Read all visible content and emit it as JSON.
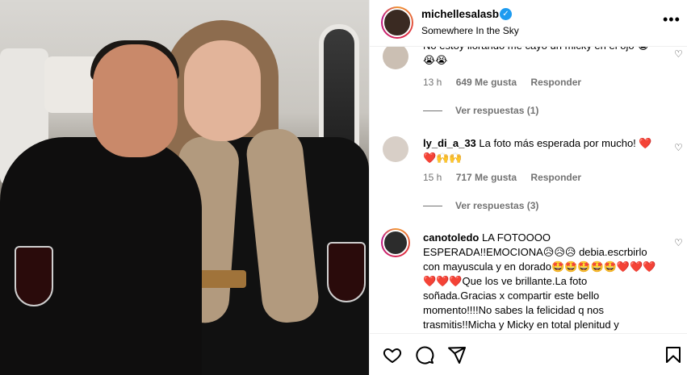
{
  "post": {
    "username": "michellesalasb",
    "location": "Somewhere In the Sky"
  },
  "comments": [
    {
      "text": "No estoy llorando me cayo un micky en el ojo 😭😭😭",
      "time": "13 h",
      "likes": "649 Me gusta",
      "reply": "Responder",
      "view_replies": "Ver respuestas (1)"
    },
    {
      "user": "ly_di_a_33",
      "text": "La foto más esperada por mucho! ❤️❤️🙌🙌",
      "time": "15 h",
      "likes": "717 Me gusta",
      "reply": "Responder",
      "view_replies": "Ver respuestas (3)"
    },
    {
      "user": "canotoledo",
      "text": "LA FOTOOOO ESPERADA!!EMOCIONA😥😥😥 debia.escrbirlo con mayuscula y en dorado🤩🤩🤩🤩🤩❤️❤️❤️❤️❤️❤️Que los ve brillante.La foto soñada.Gracias x compartir este bello momento!!!!No sabes la felicidad q nos trasmitis!!Micha y Micky en total plenitud y"
    }
  ],
  "icons": {
    "more": "more-options-icon",
    "like": "heart-icon",
    "comment": "comment-icon",
    "share": "share-icon",
    "save": "bookmark-icon"
  }
}
